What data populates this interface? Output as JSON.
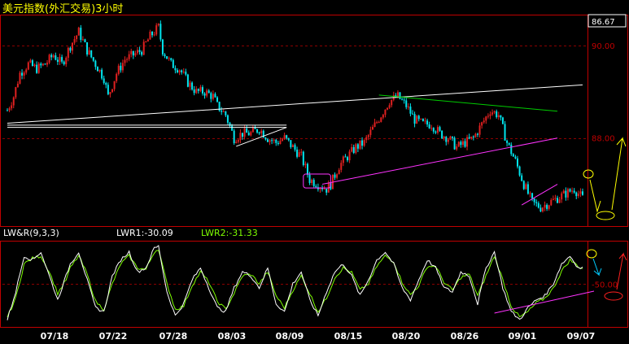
{
  "window": {
    "title": "美元指数(外汇交易)3小时"
  },
  "colors": {
    "background": "#000000",
    "frame": "#c00000",
    "grid": "#8b0000",
    "candle_up": "#e02020",
    "candle_down": "#00e5ee",
    "price_line": "#ffffff",
    "lwr1": "#ffffff",
    "lwr2": "#7fff00",
    "title": "#ffff00",
    "trend_white": "#ffffff",
    "trend_green": "#00cc00",
    "trend_magenta": "#ff33ff",
    "annotation_yellow": "#ffff00",
    "annotation_cyan": "#00ccff",
    "annotation_red": "#ff2020"
  },
  "chart_data": [
    {
      "type": "candlestick",
      "title": "美元指数(外汇交易)3小时",
      "last_price_label": "86.67",
      "y_ticks": [
        {
          "label": "90.00",
          "value": 90.0
        },
        {
          "label": "88.00",
          "value": 88.0
        }
      ],
      "x_tick_labels": [
        "07/18",
        "07/22",
        "07/28",
        "08/03",
        "08/09",
        "08/15",
        "08/20",
        "08/26",
        "09/01",
        "09/07"
      ],
      "ylim": [
        86.2,
        90.6
      ],
      "close_path": [
        [
          0,
          88.6
        ],
        [
          3,
          88.9
        ],
        [
          6,
          89.4
        ],
        [
          10,
          89.6
        ],
        [
          14,
          89.5
        ],
        [
          18,
          89.6
        ],
        [
          22,
          89.8
        ],
        [
          26,
          89.6
        ],
        [
          30,
          90.0
        ],
        [
          34,
          90.3
        ],
        [
          38,
          89.9
        ],
        [
          42,
          89.6
        ],
        [
          46,
          89.3
        ],
        [
          48,
          88.9
        ],
        [
          52,
          89.4
        ],
        [
          56,
          89.7
        ],
        [
          60,
          89.8
        ],
        [
          64,
          89.9
        ],
        [
          68,
          90.2
        ],
        [
          72,
          90.4
        ],
        [
          74,
          89.9
        ],
        [
          78,
          89.6
        ],
        [
          82,
          89.5
        ],
        [
          86,
          89.2
        ],
        [
          90,
          89.0
        ],
        [
          94,
          89.0
        ],
        [
          98,
          88.9
        ],
        [
          100,
          88.7
        ],
        [
          104,
          88.5
        ],
        [
          108,
          88.0
        ],
        [
          112,
          88.1
        ],
        [
          116,
          88.1
        ],
        [
          120,
          88.2
        ],
        [
          124,
          88.0
        ],
        [
          128,
          87.9
        ],
        [
          132,
          88.0
        ],
        [
          136,
          87.8
        ],
        [
          140,
          87.6
        ],
        [
          144,
          87.1
        ],
        [
          148,
          87.0
        ],
        [
          152,
          86.9
        ],
        [
          154,
          87.0
        ],
        [
          158,
          87.4
        ],
        [
          162,
          87.6
        ],
        [
          166,
          87.8
        ],
        [
          170,
          87.9
        ],
        [
          174,
          88.2
        ],
        [
          178,
          88.5
        ],
        [
          182,
          88.8
        ],
        [
          186,
          88.9
        ],
        [
          190,
          88.7
        ],
        [
          194,
          88.4
        ],
        [
          198,
          88.3
        ],
        [
          202,
          88.3
        ],
        [
          206,
          88.1
        ],
        [
          210,
          88.0
        ],
        [
          214,
          87.8
        ],
        [
          218,
          87.9
        ],
        [
          222,
          88.0
        ],
        [
          226,
          88.3
        ],
        [
          230,
          88.6
        ],
        [
          234,
          88.5
        ],
        [
          238,
          87.9
        ],
        [
          242,
          87.5
        ],
        [
          246,
          87.0
        ],
        [
          250,
          86.6
        ],
        [
          254,
          86.5
        ],
        [
          258,
          86.6
        ],
        [
          262,
          86.7
        ],
        [
          266,
          86.8
        ],
        [
          270,
          86.9
        ],
        [
          274,
          86.7
        ]
      ],
      "n_bars": 275,
      "candle_color_rule": "red rising, cyan falling"
    },
    {
      "type": "line",
      "indicator_label": "LW&R(9,3,3)",
      "series": [
        {
          "name": "LWR1",
          "value_label": "LWR1:-30.09",
          "current": -30.09
        },
        {
          "name": "LWR2",
          "value_label": "LWR2:-31.33",
          "current": -31.33
        }
      ],
      "reference_label": "-50.00",
      "reference_value": -50.0,
      "ylim": [
        -100,
        0
      ],
      "lwr1_path": [
        [
          0,
          -95
        ],
        [
          4,
          -60
        ],
        [
          8,
          -15
        ],
        [
          12,
          -20
        ],
        [
          16,
          -10
        ],
        [
          20,
          -40
        ],
        [
          24,
          -70
        ],
        [
          28,
          -40
        ],
        [
          30,
          -25
        ],
        [
          34,
          -10
        ],
        [
          38,
          -45
        ],
        [
          42,
          -80
        ],
        [
          46,
          -85
        ],
        [
          50,
          -40
        ],
        [
          54,
          -20
        ],
        [
          58,
          -10
        ],
        [
          62,
          -35
        ],
        [
          66,
          -30
        ],
        [
          70,
          -5
        ],
        [
          72,
          -3
        ],
        [
          76,
          -60
        ],
        [
          80,
          -90
        ],
        [
          84,
          -75
        ],
        [
          88,
          -45
        ],
        [
          92,
          -30
        ],
        [
          96,
          -55
        ],
        [
          100,
          -80
        ],
        [
          104,
          -85
        ],
        [
          108,
          -55
        ],
        [
          112,
          -35
        ],
        [
          116,
          -40
        ],
        [
          120,
          -55
        ],
        [
          124,
          -30
        ],
        [
          128,
          -75
        ],
        [
          132,
          -85
        ],
        [
          136,
          -50
        ],
        [
          140,
          -35
        ],
        [
          144,
          -70
        ],
        [
          148,
          -90
        ],
        [
          152,
          -60
        ],
        [
          156,
          -35
        ],
        [
          160,
          -25
        ],
        [
          164,
          -40
        ],
        [
          168,
          -65
        ],
        [
          172,
          -45
        ],
        [
          176,
          -20
        ],
        [
          180,
          -10
        ],
        [
          184,
          -25
        ],
        [
          188,
          -55
        ],
        [
          192,
          -70
        ],
        [
          196,
          -45
        ],
        [
          200,
          -20
        ],
        [
          204,
          -30
        ],
        [
          208,
          -55
        ],
        [
          212,
          -60
        ],
        [
          216,
          -35
        ],
        [
          220,
          -40
        ],
        [
          224,
          -75
        ],
        [
          228,
          -30
        ],
        [
          232,
          -10
        ],
        [
          236,
          -55
        ],
        [
          240,
          -85
        ],
        [
          244,
          -95
        ],
        [
          248,
          -80
        ],
        [
          252,
          -70
        ],
        [
          256,
          -65
        ],
        [
          260,
          -50
        ],
        [
          264,
          -25
        ],
        [
          268,
          -15
        ],
        [
          272,
          -30
        ],
        [
          274,
          -30
        ]
      ],
      "lwr2_path": [
        [
          0,
          -92
        ],
        [
          4,
          -68
        ],
        [
          8,
          -25
        ],
        [
          12,
          -18
        ],
        [
          16,
          -15
        ],
        [
          20,
          -35
        ],
        [
          24,
          -62
        ],
        [
          28,
          -45
        ],
        [
          30,
          -30
        ],
        [
          34,
          -15
        ],
        [
          38,
          -38
        ],
        [
          42,
          -72
        ],
        [
          46,
          -82
        ],
        [
          50,
          -50
        ],
        [
          54,
          -25
        ],
        [
          58,
          -15
        ],
        [
          62,
          -30
        ],
        [
          66,
          -32
        ],
        [
          70,
          -10
        ],
        [
          72,
          -6
        ],
        [
          76,
          -50
        ],
        [
          80,
          -82
        ],
        [
          84,
          -78
        ],
        [
          88,
          -52
        ],
        [
          92,
          -35
        ],
        [
          96,
          -48
        ],
        [
          100,
          -72
        ],
        [
          104,
          -82
        ],
        [
          108,
          -62
        ],
        [
          112,
          -40
        ],
        [
          116,
          -38
        ],
        [
          120,
          -50
        ],
        [
          124,
          -35
        ],
        [
          128,
          -65
        ],
        [
          132,
          -80
        ],
        [
          136,
          -58
        ],
        [
          140,
          -40
        ],
        [
          144,
          -62
        ],
        [
          148,
          -85
        ],
        [
          152,
          -68
        ],
        [
          156,
          -42
        ],
        [
          160,
          -30
        ],
        [
          164,
          -36
        ],
        [
          168,
          -58
        ],
        [
          172,
          -50
        ],
        [
          176,
          -28
        ],
        [
          180,
          -15
        ],
        [
          184,
          -22
        ],
        [
          188,
          -48
        ],
        [
          192,
          -64
        ],
        [
          196,
          -52
        ],
        [
          200,
          -28
        ],
        [
          204,
          -28
        ],
        [
          208,
          -48
        ],
        [
          212,
          -58
        ],
        [
          216,
          -42
        ],
        [
          220,
          -38
        ],
        [
          224,
          -65
        ],
        [
          228,
          -40
        ],
        [
          232,
          -15
        ],
        [
          236,
          -45
        ],
        [
          240,
          -78
        ],
        [
          244,
          -92
        ],
        [
          248,
          -85
        ],
        [
          252,
          -74
        ],
        [
          256,
          -68
        ],
        [
          260,
          -56
        ],
        [
          264,
          -34
        ],
        [
          268,
          -20
        ],
        [
          272,
          -28
        ],
        [
          274,
          -31
        ]
      ]
    }
  ]
}
